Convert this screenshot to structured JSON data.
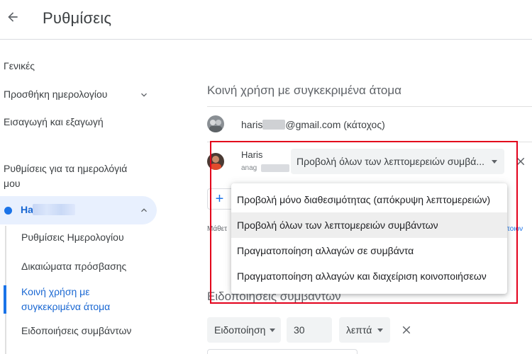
{
  "header": {
    "title": "Ρυθμίσεις"
  },
  "sidebar": {
    "general": "Γενικές",
    "add_calendar": "Προσθήκη ημερολογίου",
    "import_export": "Εισαγωγή και εξαγωγή",
    "section_title": "Ρυθμίσεις για τα ημερολόγιά μου",
    "calendar": {
      "name": "Ha",
      "color": "#1a73e8"
    },
    "sub_items": [
      "Ρυθμίσεις Ημερολογίου",
      "Δικαιώματα πρόσβασης",
      "Κοινή χρήση με συγκεκριμένα άτομα",
      "Ειδοποιήσεις συμβάντων"
    ]
  },
  "sharing": {
    "title": "Κοινή χρήση με συγκεκριμένα άτομα",
    "owner": {
      "email_prefix": "haris",
      "email_suffix": "@gmail.com (κάτοχος)"
    },
    "user": {
      "name": "Haris",
      "email_prefix": "anag",
      "permission": "Προβολή όλων των λεπτομερειών συμβά..."
    },
    "add_label": "+",
    "learn_text": "Μάθετ",
    "learn_link": "ποιον"
  },
  "permission_menu": {
    "options": [
      "Προβολή μόνο διαθεσιμότητας (απόκρυψη λεπτομερειών)",
      "Προβολή όλων των λεπτομερειών συμβάντων",
      "Πραγματοποίηση αλλαγών σε συμβάντα",
      "Πραγματοποίηση αλλαγών και διαχείριση κοινοποιήσεων"
    ],
    "selected": "Προβολή όλων των λεπτομερειών συμβάντων"
  },
  "notifications": {
    "title": "Ειδοποιήσεις συμβάντων",
    "type": "Ειδοποίηση",
    "amount": "30",
    "unit": "λεπτά"
  },
  "colors": {
    "accent": "#1a73e8",
    "highlight": "#e3001b"
  }
}
